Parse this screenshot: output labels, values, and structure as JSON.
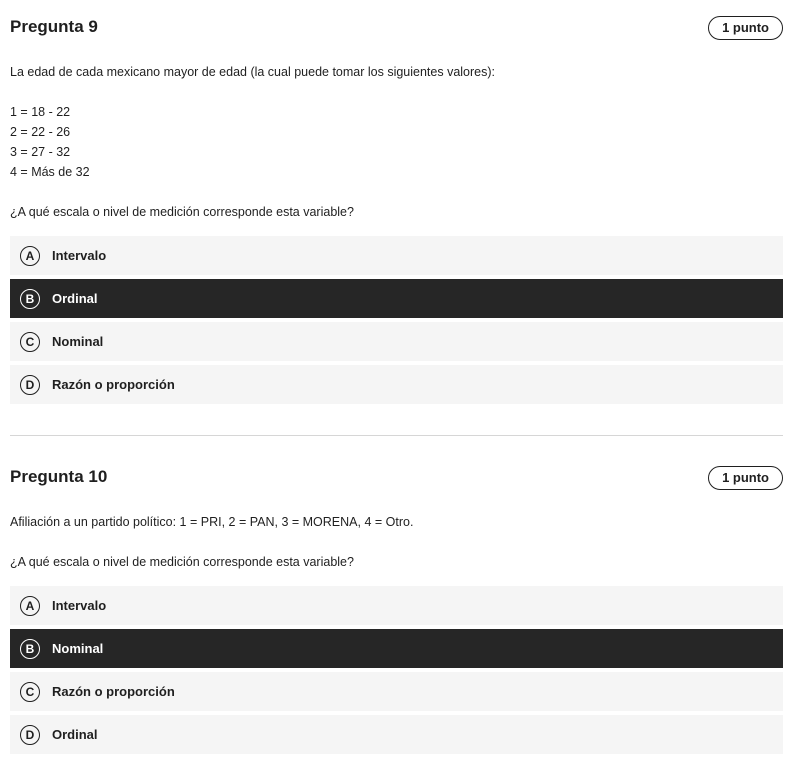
{
  "questions": [
    {
      "title": "Pregunta 9",
      "points": "1 punto",
      "prompt": "La edad de cada mexicano mayor de edad (la cual puede tomar los siguientes valores):",
      "values": [
        "1 = 18 - 22",
        "2 = 22 - 26",
        "3 = 27 - 32",
        "4 = Más de 32"
      ],
      "question": "¿A qué escala o nivel de medición corresponde esta variable?",
      "options": [
        {
          "letter": "A",
          "label": "Intervalo",
          "selected": false
        },
        {
          "letter": "B",
          "label": "Ordinal",
          "selected": true
        },
        {
          "letter": "C",
          "label": "Nominal",
          "selected": false
        },
        {
          "letter": "D",
          "label": "Razón o proporción",
          "selected": false
        }
      ]
    },
    {
      "title": "Pregunta 10",
      "points": "1 punto",
      "prompt": "Afiliación a un partido político: 1 = PRI, 2 = PAN, 3 = MORENA, 4 = Otro.",
      "question": "¿A qué escala o nivel de medición corresponde esta variable?",
      "options": [
        {
          "letter": "A",
          "label": "Intervalo",
          "selected": false
        },
        {
          "letter": "B",
          "label": "Nominal",
          "selected": true
        },
        {
          "letter": "C",
          "label": "Razón o proporción",
          "selected": false
        },
        {
          "letter": "D",
          "label": "Ordinal",
          "selected": false
        }
      ]
    }
  ],
  "colors": {
    "selected_background": "#262626",
    "option_background": "#f5f5f5",
    "divider": "#d6d6d6"
  }
}
